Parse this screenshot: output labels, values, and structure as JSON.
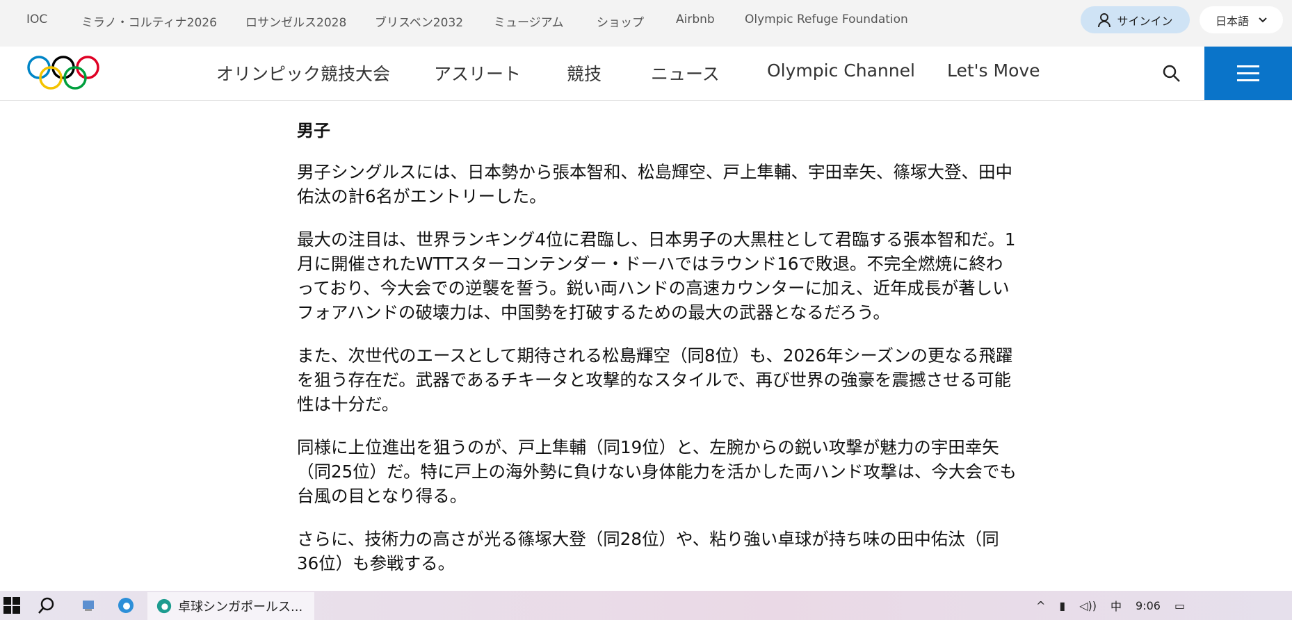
{
  "topbar": {
    "links": [
      "IOC",
      "ミラノ・コルティナ2026",
      "ロサンゼルス2028",
      "ブリスベン2032",
      "ミュージアム",
      "ショップ",
      "Airbnb",
      "Olympic Refuge Foundation"
    ],
    "signin": "サインイン",
    "language": "日本語"
  },
  "nav": {
    "links": [
      "オリンピック競技大会",
      "アスリート",
      "競技",
      "ニュース",
      "Olympic Channel",
      "Let's Move"
    ]
  },
  "article": {
    "heading": "男子",
    "paragraphs": [
      [
        "男子シングルスには、日本勢から張本智和、松島輝空、戸上隼輔、宇田幸矢、篠塚大登、田中",
        "佑汰の計6名がエントリーした。"
      ],
      [
        "最大の注目は、世界ランキング4位に君臨し、日本男子の大黒柱として君臨する張本智和だ。1",
        "月に開催されたWTTスターコンテンダー・ドーハではラウンド16で敗退。不完全燃焼に終わ",
        "っており、今大会での逆襲を誓う。鋭い両ハンドの高速カウンターに加え、近年成長が著しい",
        "フォアハンドの破壊力は、中国勢を打破するための最大の武器となるだろう。"
      ],
      [
        "また、次世代のエースとして期待される松島輝空（同8位）も、2026年シーズンの更なる飛躍",
        "を狙う存在だ。武器であるチキータと攻撃的なスタイルで、再び世界の強豪を震撼させる可能",
        "性は十分だ。"
      ],
      [
        "同様に上位進出を狙うのが、戸上隼輔（同19位）と、左腕からの鋭い攻撃が魅力の宇田幸矢",
        "（同25位）だ。特に戸上の海外勢に負けない身体能力を活かした両ハンド攻撃は、今大会でも",
        "台風の目となり得る。"
      ],
      [
        "さらに、技術力の高さが光る篠塚大登（同28位）や、粘り強い卓球が持ち味の田中佑汰（同",
        "36位）も参戦する。"
      ]
    ]
  },
  "taskbar": {
    "app": "卓球シンガポールス...",
    "time": "9:06"
  }
}
